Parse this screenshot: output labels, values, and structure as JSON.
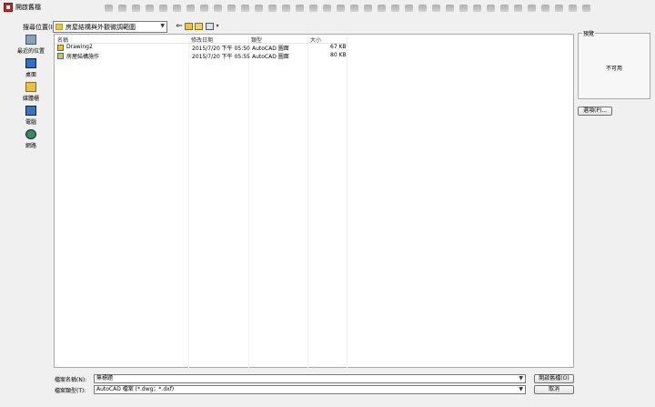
{
  "window": {
    "title": "開啟舊檔"
  },
  "lookin": {
    "label": "搜尋位置(I):",
    "value": "房屋結構與外觀微調範圍"
  },
  "toolbar": {
    "back_glyph": "⇐",
    "view_glyph": "▾"
  },
  "places": [
    {
      "label": "最近的位置",
      "icon": "recent-places-icon"
    },
    {
      "label": "桌面",
      "icon": "desktop-icon"
    },
    {
      "label": "媒體櫃",
      "icon": "libraries-icon"
    },
    {
      "label": "電腦",
      "icon": "computer-icon"
    },
    {
      "label": "網路",
      "icon": "network-icon"
    }
  ],
  "filelist": {
    "columns": [
      "名稱",
      "修改日期",
      "類型",
      "大小"
    ],
    "rows": [
      {
        "name": "Drawing2",
        "date": "2015/7/20 下午 05:50",
        "type": "AutoCAD 圖面",
        "size": "67 KB"
      },
      {
        "name": "房屋結構施作",
        "date": "2015/7/20 下午 05:55",
        "type": "AutoCAD 圖面",
        "size": "80 KB"
      }
    ]
  },
  "preview": {
    "label": "預覽",
    "unavailable": "不可用"
  },
  "options_button": "選項(P)...",
  "filename": {
    "label": "檔案名稱(N):",
    "value": "無標題"
  },
  "filetype": {
    "label": "檔案類型(T):",
    "value": "AutoCAD 檔案 (*.dwg；*.dxf)"
  },
  "buttons": {
    "open": "開啟舊檔(O)",
    "cancel": "取消"
  },
  "colors": {
    "accent": "#c02828",
    "folder": "#e8c44a"
  }
}
